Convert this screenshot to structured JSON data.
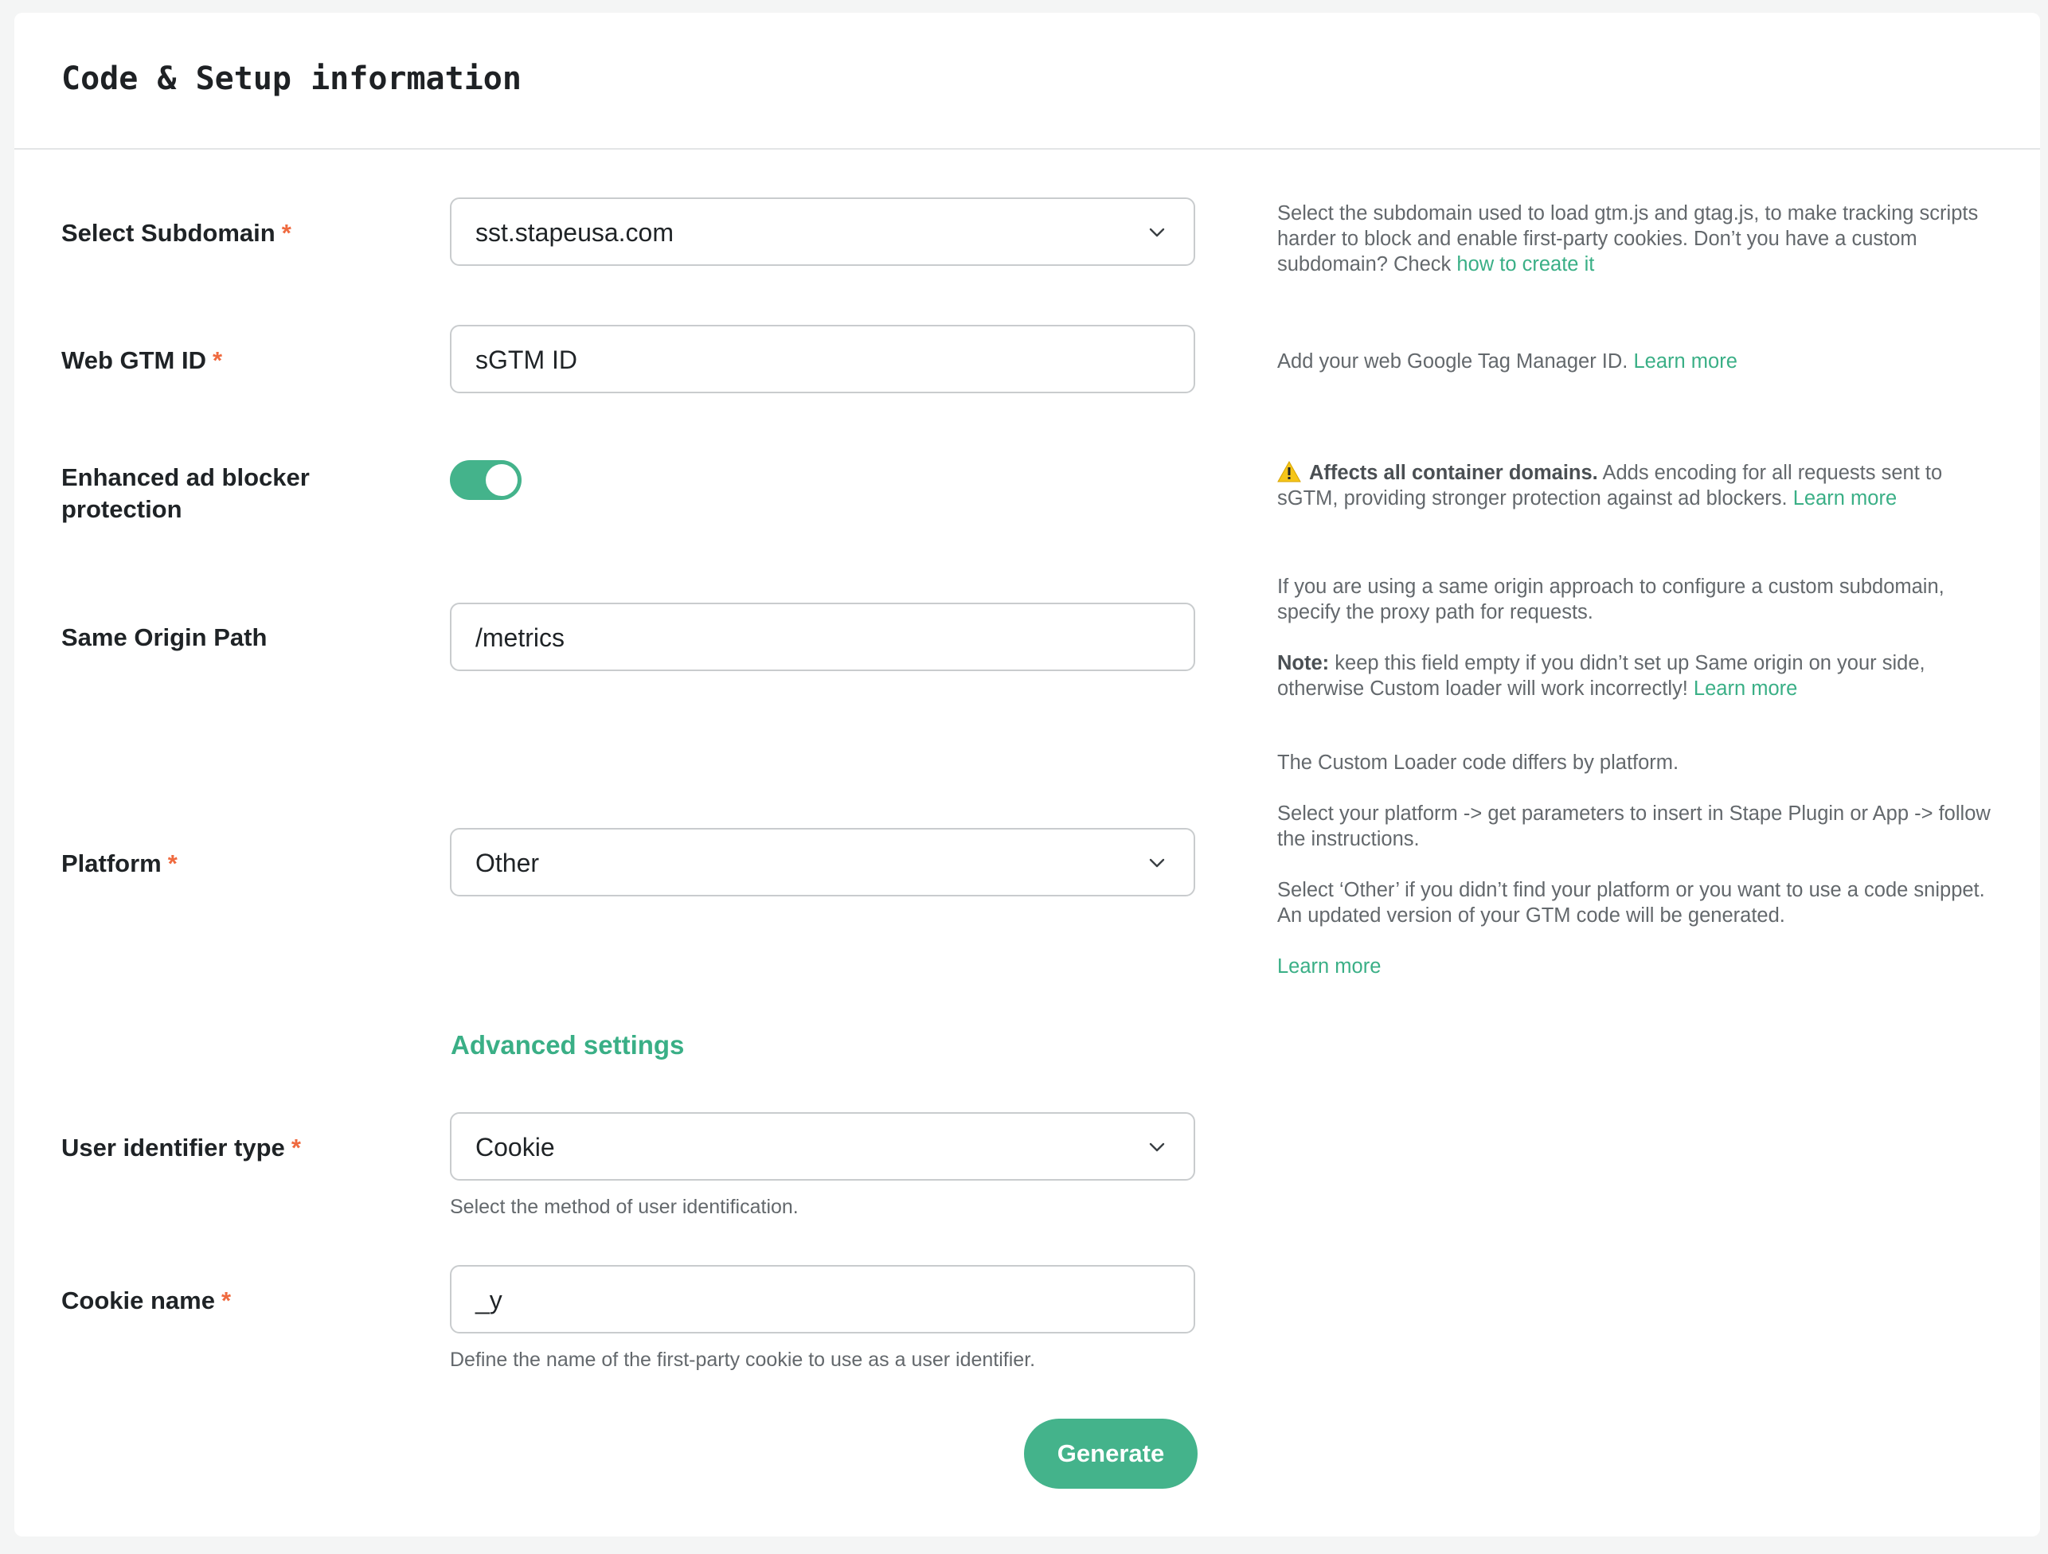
{
  "header": {
    "title": "Code & Setup information"
  },
  "required_mark": "*",
  "subdomain": {
    "label": "Select Subdomain",
    "value": "sst.stapeusa.com",
    "help_text": "Select the subdomain used to load gtm.js and gtag.js, to make tracking scripts harder to block and enable first-party cookies. Don’t you have a custom subdomain? Check",
    "help_link": "how to create it"
  },
  "web_gtm": {
    "label": "Web GTM ID",
    "value": "sGTM ID",
    "help_text": "Add your web Google Tag Manager ID.",
    "help_link": "Learn more"
  },
  "adblock": {
    "label": "Enhanced ad blocker protection",
    "enabled": true,
    "warning_title": "Affects all container domains.",
    "help_text": "Adds encoding for all requests sent to sGTM, providing stronger protection against ad blockers.",
    "help_link": "Learn more"
  },
  "same_origin": {
    "label": "Same Origin Path",
    "value": "/metrics",
    "help_text": "If you are using a same origin approach to configure a custom subdomain, specify the proxy path for requests.",
    "note_label": "Note:",
    "note_text": "keep this field empty if you didn’t set up Same origin on your side, otherwise Custom loader will work incorrectly!",
    "help_link": "Learn more"
  },
  "platform": {
    "label": "Platform",
    "value": "Other",
    "help_p1": "The Custom Loader code differs by platform.",
    "help_p2": "Select your platform -> get parameters to insert in Stape Plugin or App -> follow the instructions.",
    "help_p3": "Select ‘Other’ if you didn’t find your platform or you want to use a code snippet. An updated version of your GTM code will be generated.",
    "help_link": "Learn more"
  },
  "advanced": {
    "label": "Advanced settings"
  },
  "user_id_type": {
    "label": "User identifier type",
    "value": "Cookie",
    "hint": "Select the method of user identification."
  },
  "cookie_name": {
    "label": "Cookie name",
    "value": "_y",
    "hint": "Define the name of the first-party cookie to use as a user identifier."
  },
  "actions": {
    "generate_label": "Generate"
  },
  "colors": {
    "accent": "#44b38b",
    "link": "#3aaf86",
    "required": "#ef6a3f",
    "warning": "#f5c518"
  },
  "icons": {
    "dropdown": "chevron-down-icon",
    "warning": "warning-icon"
  }
}
